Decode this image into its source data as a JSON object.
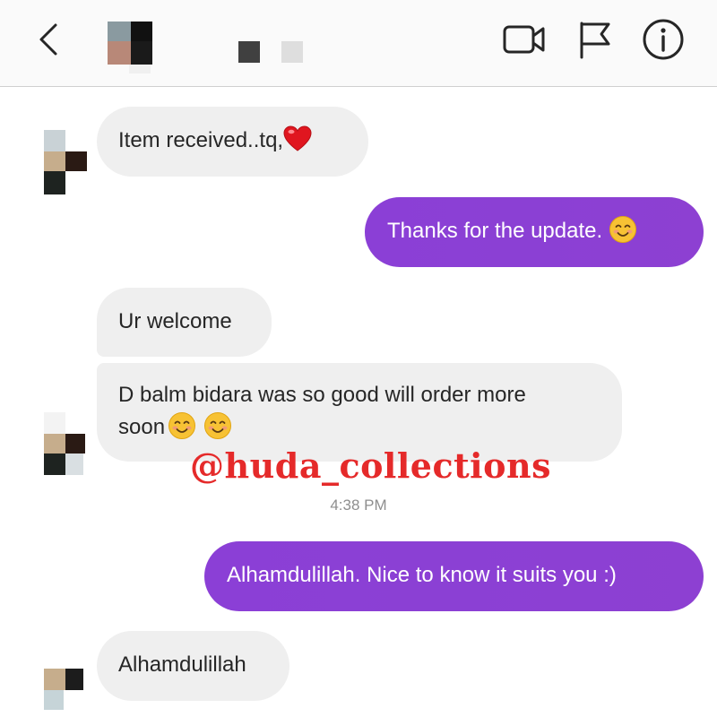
{
  "header": {
    "icons": [
      "back-icon",
      "video-call-icon",
      "report-flag-icon",
      "info-icon"
    ]
  },
  "messages": [
    {
      "side": "incoming",
      "text": "Item received..tq,",
      "emoji": "red-heart"
    },
    {
      "side": "outgoing",
      "text": "Thanks for the update.",
      "emoji": "smiling-face"
    },
    {
      "side": "incoming",
      "text": "Ur welcome"
    },
    {
      "side": "incoming",
      "text_line1": "D balm bidara was so good will order more",
      "text_line2": "soon",
      "emoji": "smiling-face x2"
    },
    {
      "side": "outgoing",
      "text": "Alhamdulillah. Nice to know it suits you :)"
    },
    {
      "side": "incoming",
      "text": "Alhamdulillah"
    }
  ],
  "timestamp": "4:38 PM",
  "watermark": "@huda_collections",
  "colors": {
    "outgoing_bubble": "#8b3fd6",
    "incoming_bubble": "#efefef",
    "header_bg": "#fafafa",
    "timestamp": "#8e8e8e",
    "watermark": "#e52a2a"
  }
}
